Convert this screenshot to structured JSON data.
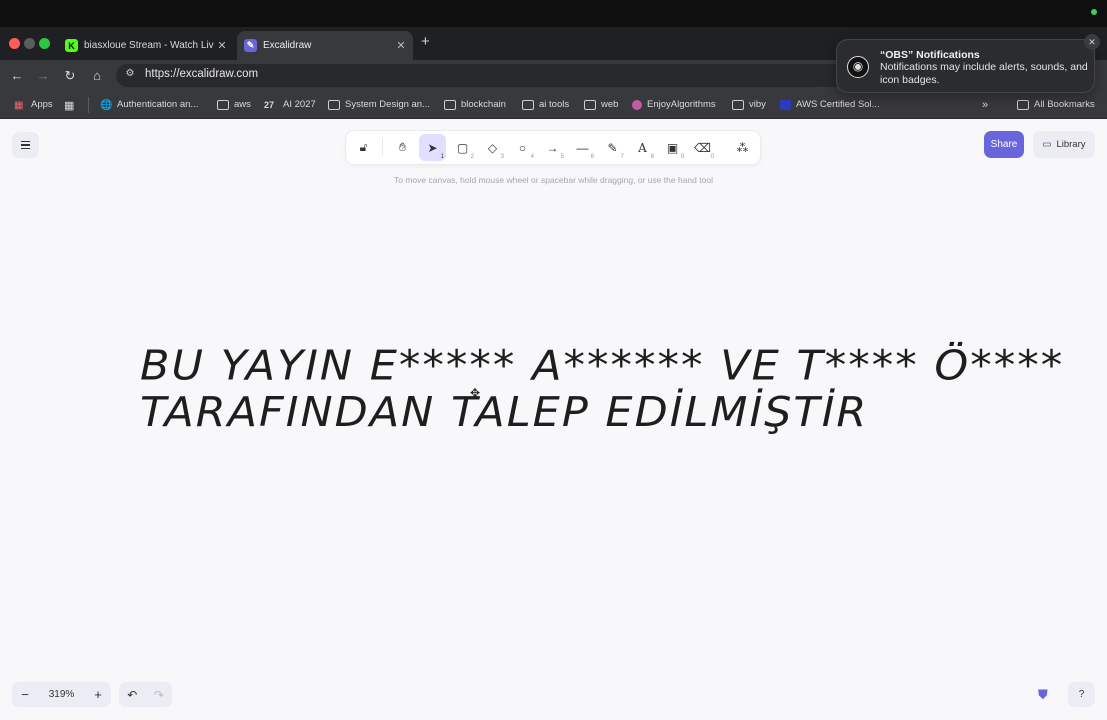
{
  "browser": {
    "tabs": [
      {
        "title": "biasxloue Stream - Watch Live",
        "favicon": "kick-icon",
        "color": "#53fc18"
      },
      {
        "title": "Excalidraw",
        "favicon": "excalidraw-icon",
        "color": "#6965db"
      }
    ],
    "url": "https://excalidraw.com",
    "bookmarks": [
      {
        "label": "Apps",
        "icon": "grid-icon"
      },
      {
        "label": "Authentication an...",
        "icon": "globe-icon"
      },
      {
        "label": "aws",
        "icon": "folder-icon"
      },
      {
        "label": "AI 2027",
        "icon": "27-icon"
      },
      {
        "label": "System Design an...",
        "icon": "folder-icon"
      },
      {
        "label": "blockchain",
        "icon": "folder-icon"
      },
      {
        "label": "ai tools",
        "icon": "folder-icon"
      },
      {
        "label": "web",
        "icon": "folder-icon"
      },
      {
        "label": "EnjoyAlgorithms",
        "icon": "site-icon"
      },
      {
        "label": "viby",
        "icon": "folder-icon"
      },
      {
        "label": "AWS Certified Sol...",
        "icon": "site-icon"
      }
    ],
    "all_bookmarks": "All Bookmarks"
  },
  "notification": {
    "title": "“OBS” Notifications",
    "body": "Notifications may include alerts, sounds, and icon badges."
  },
  "excalidraw": {
    "tools": [
      {
        "name": "lock",
        "key": ""
      },
      {
        "name": "hand",
        "key": ""
      },
      {
        "name": "selection",
        "key": "1"
      },
      {
        "name": "rectangle",
        "key": "2"
      },
      {
        "name": "diamond",
        "key": "3"
      },
      {
        "name": "ellipse",
        "key": "4"
      },
      {
        "name": "arrow",
        "key": "5"
      },
      {
        "name": "line",
        "key": "6"
      },
      {
        "name": "draw",
        "key": "7"
      },
      {
        "name": "text",
        "key": "8"
      },
      {
        "name": "image",
        "key": "9"
      },
      {
        "name": "eraser",
        "key": "0"
      },
      {
        "name": "more-tools",
        "key": ""
      }
    ],
    "hint": "To move canvas, hold mouse wheel or spacebar while dragging, or use the hand tool",
    "share_label": "Share",
    "library_label": "Library",
    "zoom": "319%",
    "canvas_text_line1": "BU YAYIN E***** A****** VE T**** Ö****",
    "canvas_text_line2": "TARAFINDAN TALEP EDİLMİŞTİR",
    "accent": "#6965db"
  }
}
